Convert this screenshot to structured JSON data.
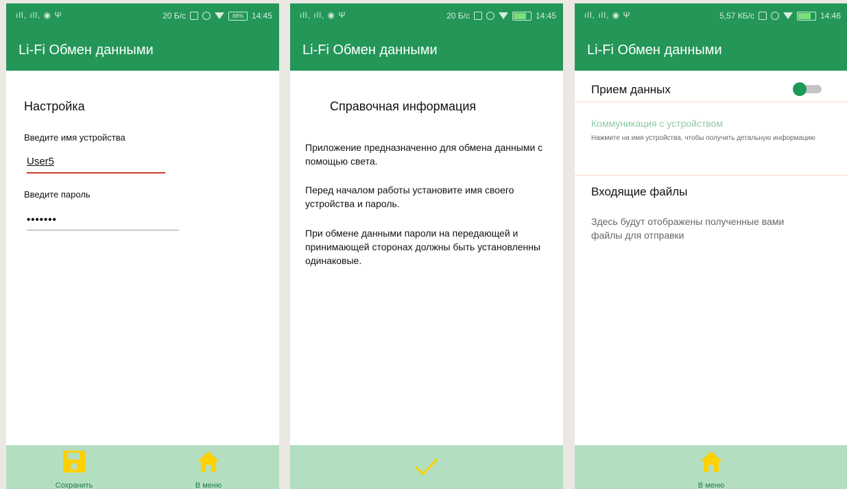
{
  "status": {
    "signal": "ıll, ıll, ◉ Ψ",
    "p1_speed": "20 Б/с",
    "p2_speed": "20 Б/с",
    "p3_speed": "5,57 КБ/с",
    "p1_time": "14:45",
    "p2_time": "14:45",
    "p3_time": "14:46",
    "battery_label": "88%"
  },
  "app_title": "Li-Fi  Обмен данными",
  "settings": {
    "title": "Настройка",
    "device_label": "Введите имя устройства",
    "device_value": "User5",
    "password_label": "Введите пароль",
    "password_value": "•••••••",
    "save_label": "Сохранить",
    "menu_label": "В меню"
  },
  "help": {
    "title": "Справочная информация",
    "p1": "Приложение предназначенно для обмена данными с помощью света.",
    "p2": "Перед началом работы установите имя своего устройства и пароль.",
    "p3": "При обмене данными пароли на передающей и принимающей сторонах должны быть установленны одинаковые."
  },
  "receive": {
    "toggle_label": "Прием данных",
    "toggle_on": true,
    "comm_title": "Коммуникация с устройством",
    "comm_subtitle": "Нажмите на имя устройства, чтобы получить детальную информацию",
    "incoming_title": "Входящие файлы",
    "incoming_desc": "Здесь будут отображены полученные вами файлы для отправки",
    "menu_label": "В меню"
  },
  "colors": {
    "primary": "#239658",
    "bottom_bar": "#b3dfc0",
    "icon_yellow": "#fdd000",
    "error_underline": "#c6402a"
  }
}
